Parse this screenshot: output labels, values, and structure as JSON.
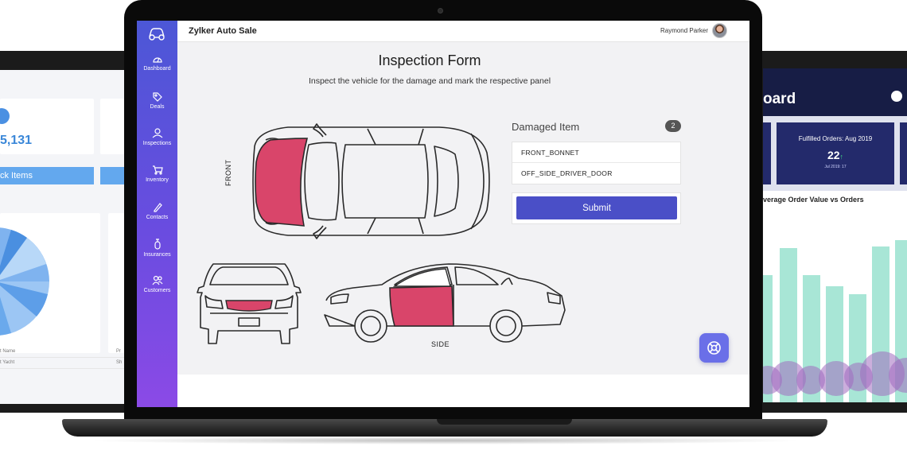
{
  "left_screen": {
    "big_number": "5,131",
    "bar_label": "ck Items",
    "table_rows": [
      "t Name",
      "t Yacht"
    ],
    "table_col2": [
      "Pr",
      "Sh"
    ]
  },
  "right_screen": {
    "title": "oard",
    "card_label": "Fulfilled Orders: Aug 2019",
    "card_value": "22",
    "card_trend": "↑",
    "card_sub": "Jul 2019: 17",
    "chart_title": "verage Order Value vs Orders"
  },
  "app": {
    "name": "Zylker Auto Sale",
    "user": "Raymond Parker",
    "accent": "#4a4fc7",
    "sidebar_items": [
      {
        "label": "Dashboard",
        "icon": "dashboard-icon"
      },
      {
        "label": "Deals",
        "icon": "tag-icon"
      },
      {
        "label": "Inspections",
        "icon": "inspector-icon"
      },
      {
        "label": "Inventory",
        "icon": "cart-icon"
      },
      {
        "label": "Contacts",
        "icon": "pen-icon"
      },
      {
        "label": "Insurances",
        "icon": "shield-icon"
      },
      {
        "label": "Customers",
        "icon": "people-icon"
      }
    ]
  },
  "form": {
    "title": "Inspection Form",
    "subtitle": "Inspect the vehicle for the damage and mark the respective panel",
    "front_label": "FRONT",
    "side_label": "SIDE",
    "damaged_title": "Damaged Item",
    "damaged_count": "2",
    "damaged_items": [
      "FRONT_BONNET",
      "OFF_SIDE_DRIVER_DOOR"
    ],
    "submit_label": "Submit",
    "damage_color": "#d9456a"
  }
}
